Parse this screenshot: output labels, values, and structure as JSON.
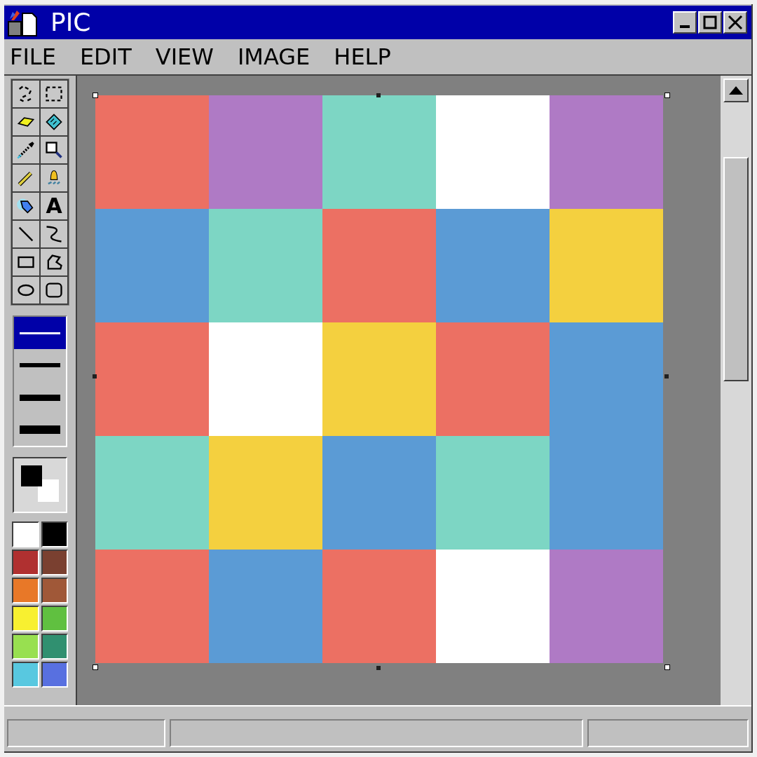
{
  "window": {
    "title": "PIC"
  },
  "menu": [
    "FILE",
    "EDIT",
    "VIEW",
    "IMAGE",
    "HELP"
  ],
  "text_tool_glyph": "A",
  "line_widths": [
    {
      "selected": true
    },
    {
      "selected": false
    },
    {
      "selected": false
    },
    {
      "selected": false
    }
  ],
  "current_colors": {
    "foreground": {
      "color": "#000000"
    },
    "background": {
      "color": "#ffffff"
    }
  },
  "palette": [
    {
      "color": "#ffffff"
    },
    {
      "color": "#000000"
    },
    {
      "color": "#b03030"
    },
    {
      "color": "#7a4030"
    },
    {
      "color": "#e87828"
    },
    {
      "color": "#a05838"
    },
    {
      "color": "#f8f030"
    },
    {
      "color": "#60c040"
    },
    {
      "color": "#98e050"
    },
    {
      "color": "#309070"
    },
    {
      "color": "#58c8e0"
    },
    {
      "color": "#5870e0"
    }
  ],
  "canvas": {
    "rows": [
      [
        {
          "color": "#ec7063"
        },
        {
          "color": "#af7ac5"
        },
        {
          "color": "#7dd6c4"
        },
        {
          "color": "#ffffff"
        },
        {
          "color": "#af7ac5"
        }
      ],
      [
        {
          "color": "#5b9bd5"
        },
        {
          "color": "#7dd6c4"
        },
        {
          "color": "#ec7063"
        },
        {
          "color": "#5b9bd5"
        },
        {
          "color": "#f4d03f"
        }
      ],
      [
        {
          "color": "#ec7063"
        },
        {
          "color": "#ffffff"
        },
        {
          "color": "#f4d03f"
        },
        {
          "color": "#ec7063"
        },
        {
          "color": "#5b9bd5"
        }
      ],
      [
        {
          "color": "#7dd6c4"
        },
        {
          "color": "#f4d03f"
        },
        {
          "color": "#5b9bd5"
        },
        {
          "color": "#7dd6c4"
        },
        {
          "color": "#5b9bd5"
        }
      ],
      [
        {
          "color": "#ec7063"
        },
        {
          "color": "#5b9bd5"
        },
        {
          "color": "#ec7063"
        },
        {
          "color": "#ffffff"
        },
        {
          "color": "#af7ac5"
        }
      ]
    ]
  }
}
